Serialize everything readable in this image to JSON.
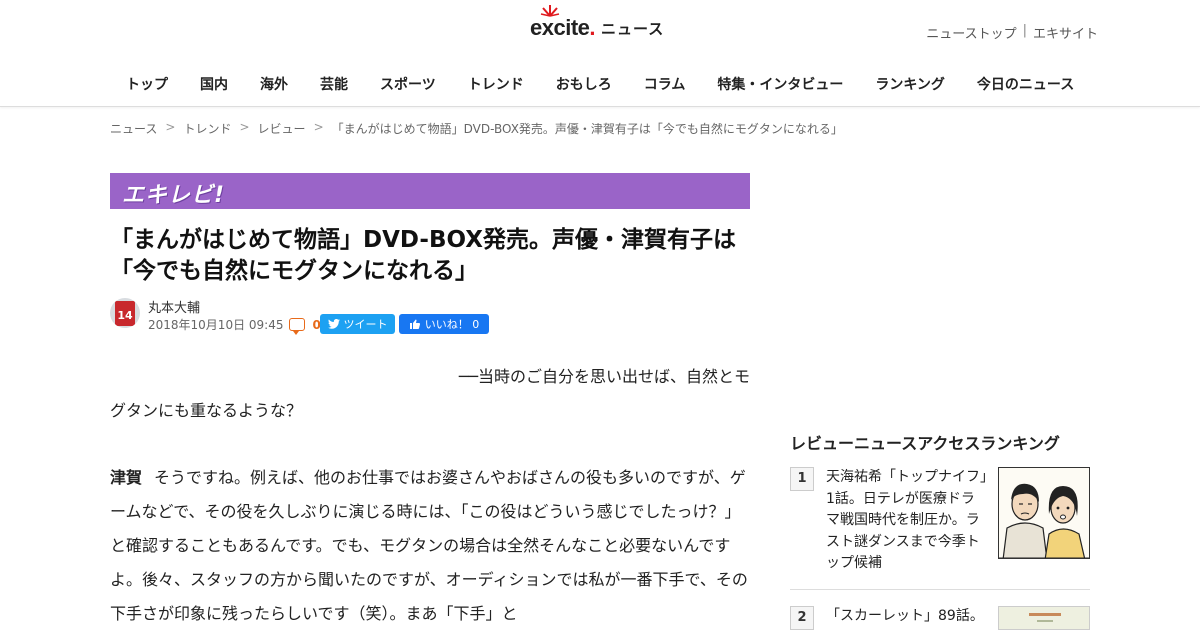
{
  "header": {
    "logo_text": "excite",
    "logo_section": "ニュース",
    "top_links": [
      "ニューストップ",
      "エキサイト"
    ],
    "nav": [
      "トップ",
      "国内",
      "海外",
      "芸能",
      "スポーツ",
      "トレンド",
      "おもしろ",
      "コラム",
      "特集・インタビュー",
      "ランキング",
      "今日のニュース"
    ]
  },
  "breadcrumb": [
    "ニュース",
    "トレンド",
    "レビュー",
    "「まんがはじめて物語」DVD-BOX発売。声優・津賀有子は「今でも自然にモグタンになれる」"
  ],
  "article": {
    "section_banner": "エキレビ!",
    "title": "「まんがはじめて物語」DVD-BOX発売。声優・津賀有子は「今でも自然にモグタンになれる」",
    "author": "丸本大輔",
    "avatar_badge": "14",
    "date": "2018年10月10日 09:45",
    "comment_count": "0",
    "tweet_label": "ツイート",
    "like_label": "いいね！ 0",
    "q_line1": "──当時のご自分を思い出せば、自然とモ",
    "q_line2": "グタンにも重なるような？",
    "speaker": "津賀",
    "answer": "そうですね。例えば、他のお仕事ではお婆さんやおばさんの役も多いのですが、ゲームなどで、その役を久しぶりに演じる時には、「この役はどういう感じでしたっけ？」と確認することもあるんです。でも、モグタンの場合は全然そんなこと必要ないんですよ。後々、スタッフの方から聞いたのですが、オーディションでは私が一番下手で、その下手さが印象に残ったらしいです（笑）。まあ「下手」と"
  },
  "sidebar": {
    "ranking_title": "レビューニュースアクセスランキング",
    "items": [
      {
        "rank": "1",
        "text": "天海祐希「トップナイフ」1話。日テレが医療ドラマ戦国時代を制圧か。ラスト謎ダンスまで今季トップ候補"
      },
      {
        "rank": "2",
        "text": "「スカーレット」89話。"
      }
    ]
  },
  "colors": {
    "banner": "#9a64c8",
    "comment": "#e86a1a",
    "twitter": "#1da1f2",
    "facebook": "#1877f2"
  }
}
